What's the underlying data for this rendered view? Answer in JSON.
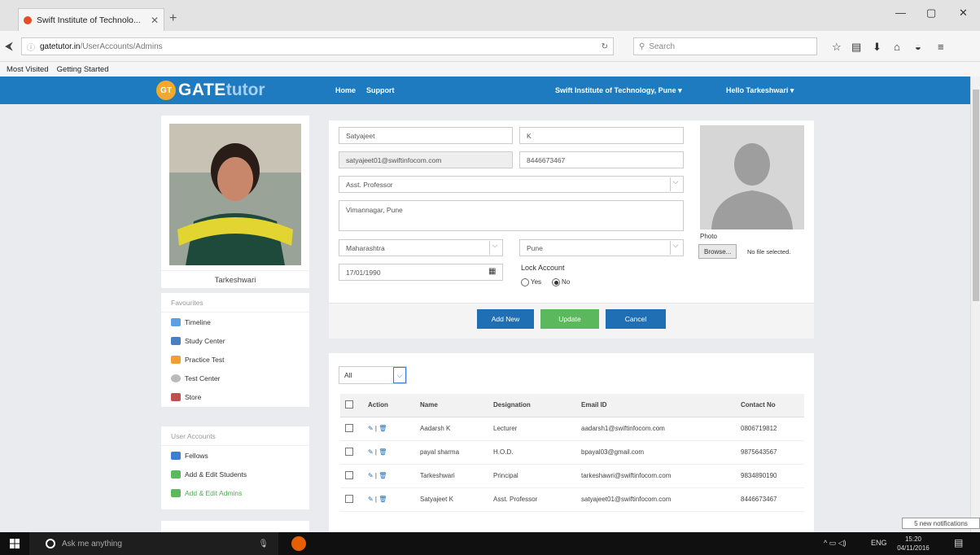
{
  "browser": {
    "tab_title": "Swift Institute of Technolo...",
    "url_domain": "gatetutor.in",
    "url_path": "/UserAccounts/Admins",
    "search_placeholder": "Search",
    "bookmarks": [
      "Most Visited",
      "Getting Started"
    ]
  },
  "header": {
    "logo_gt": "GT",
    "logo_part1": "GATE",
    "logo_part2": "tutor",
    "nav": [
      "Home",
      "Support"
    ],
    "institute": "Swift Institute of Technology, Pune ▾",
    "greeting": "Hello Tarkeshwari ▾"
  },
  "profile": {
    "name": "Tarkeshwari"
  },
  "sidebar": {
    "favourites_title": "Favourites",
    "favourites": [
      {
        "label": "Timeline",
        "color": "#5aa0e0"
      },
      {
        "label": "Study Center",
        "color": "#4a7fc1"
      },
      {
        "label": "Practice Test",
        "color": "#f0a030"
      },
      {
        "label": "Test Center",
        "color": "#bbbbbb"
      },
      {
        "label": "Store",
        "color": "#c05050"
      }
    ],
    "accounts_title": "User Accounts",
    "accounts": [
      {
        "label": "Fellows",
        "color": "#3a7fd0"
      },
      {
        "label": "Add & Edit Students",
        "color": "#5cb85c"
      },
      {
        "label": "Add & Edit Admins",
        "color": "#5cb85c"
      }
    ]
  },
  "form": {
    "first_name": "Satyajeet",
    "last_name": "K",
    "email": "satyajeet01@swiftinfocom.com",
    "phone": "8446673467",
    "designation": "Asst. Professor",
    "address": "Vimannagar, Pune",
    "state": "Maharashtra",
    "city": "Pune",
    "dob": "17/01/1990",
    "lock_label": "Lock Account",
    "yes": "Yes",
    "no": "No",
    "photo_label": "Photo",
    "browse": "Browse...",
    "no_file": "No file selected.",
    "add_new": "Add New",
    "update": "Update",
    "cancel": "Cancel"
  },
  "table": {
    "filter": "All",
    "headers": [
      "Action",
      "Name",
      "Designation",
      "Email ID",
      "Contact No"
    ],
    "rows": [
      {
        "name": "Aadarsh K",
        "designation": "Lecturer",
        "email": "aadarsh1@swiftinfocom.com",
        "contact": "0806719812"
      },
      {
        "name": "payal sharma",
        "designation": "H.O.D.",
        "email": "bpayal03@gmail.com",
        "contact": "9875643567"
      },
      {
        "name": "Tarkeshwari",
        "designation": "Principal",
        "email": "tarkeshawri@swiftinfocom.com",
        "contact": "9834890190"
      },
      {
        "name": "Satyajeet K",
        "designation": "Asst. Professor",
        "email": "satyajeet01@swiftinfocom.com",
        "contact": "8446673467"
      }
    ]
  },
  "taskbar": {
    "cortana": "Ask me anything",
    "lang": "ENG",
    "time": "15:20",
    "date": "04/11/2016",
    "notifications": "5 new notifications"
  }
}
